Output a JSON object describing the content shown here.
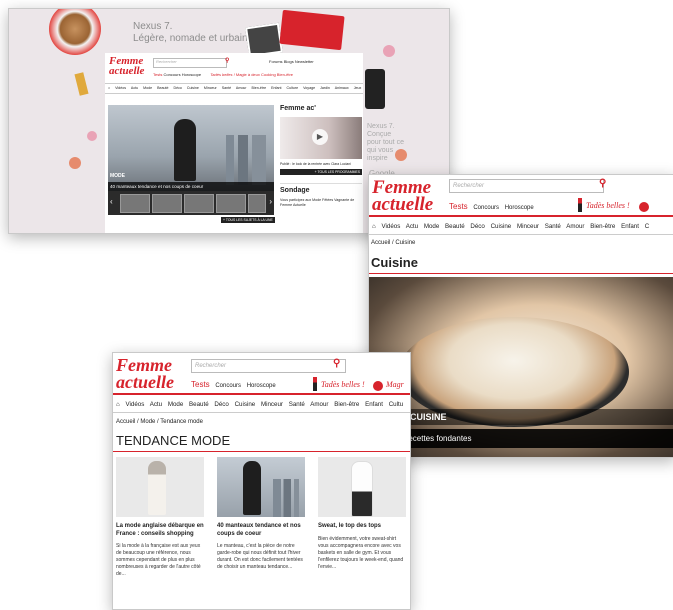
{
  "shot1": {
    "promo_title": "Nexus 7.",
    "promo_subtitle": "Légère, nomade et urbaine.",
    "promo_side": "Nexus 7. Conçue pour tout ce qui vous inspire",
    "google_text": "Google",
    "logo_line1": "Femme",
    "logo_line2": "actuelle",
    "search_placeholder": "Rechercher",
    "top_links": [
      "Forums",
      "Blogs",
      "Newsletter"
    ],
    "sub_tabs": [
      "Tests",
      "Concours",
      "Horoscope"
    ],
    "promo_tag": "Tadès belles !",
    "promo_tag2": "Magie à deux",
    "promo_tag3": "Cooking Bien-être",
    "nav_items": [
      "Vidéos",
      "Actu",
      "Mode",
      "Beauté",
      "Déco",
      "Cuisine",
      "Minceur",
      "Santé",
      "Amour",
      "Bien-être",
      "Enfant",
      "Culture",
      "Voyage",
      "Jardin",
      "Animaux",
      "Jeux"
    ],
    "hero_category": "MODE",
    "hero_title": "40 manteaux tendance et nos coups de coeur",
    "all_slides_link": "+ TOUS LES SUJETS À LA UNE",
    "rail_title": "Femme ac'",
    "rail_video_caption": "Publié : le look de la rentrée avec Clara Luciani",
    "rail_programs_link": "+ TOUS LES PROGRAMMES",
    "poll_title": "Sondage",
    "poll_text": "Vous participez aux Mode Fêtées Vagnante de Femme Actuelle"
  },
  "shot2": {
    "logo_line1": "Femme",
    "logo_line2": "actuelle",
    "search_placeholder": "Rechercher",
    "sub_tabs": [
      "Tests",
      "Concours",
      "Horoscope"
    ],
    "promo_tag": "Tadès belles !",
    "nav_items": [
      "Vidéos",
      "Actu",
      "Mode",
      "Beauté",
      "Déco",
      "Cuisine",
      "Minceur",
      "Santé",
      "Amour",
      "Bien-être",
      "Enfant",
      "C"
    ],
    "breadcrumb_home": "Accueil",
    "breadcrumb_current": "Cuisine",
    "page_title": "Cuisine",
    "hero_caption_top": "TES DE CUISINE",
    "hero_caption_bottom": "rty : nos recettes fondantes"
  },
  "shot3": {
    "logo_line1": "Femme",
    "logo_line2": "actuelle",
    "search_placeholder": "Rechercher",
    "sub_tabs": [
      "Tests",
      "Concours",
      "Horoscope"
    ],
    "promo_tag": "Tadès belles !",
    "promo_tag2": "Magr",
    "nav_items": [
      "Vidéos",
      "Actu",
      "Mode",
      "Beauté",
      "Déco",
      "Cuisine",
      "Minceur",
      "Santé",
      "Amour",
      "Bien-être",
      "Enfant",
      "Cultu"
    ],
    "breadcrumb": [
      "Accueil",
      "Mode",
      "Tendance mode"
    ],
    "page_title": "TENDANCE MODE",
    "cards": [
      {
        "title": "La mode anglaise débarque en France : conseils shopping",
        "desc": "Si la mode à la française est aux yeux de beaucoup une référence, nous sommes cependant de plus en plus nombreuses à regarder de l'autre côté de..."
      },
      {
        "title": "40 manteaux tendance et nos coups de coeur",
        "desc": "Le manteau, c'est la pièce de notre garde-robe qui nous définit tout l'hiver durant. On est donc facilement tentées de choisir un manteau tendance..."
      },
      {
        "title": "Sweat, le top des tops",
        "desc": "Bien évidemment, votre sweat-shirt vous accompagnera encore avec vos baskets en salle de gym. Et vous l'enfilerez toujours le week-end, quand l'envie..."
      }
    ]
  },
  "colors": {
    "brand_red": "#d7232c",
    "text": "#222222",
    "promo_bg": "#ece6e9"
  }
}
